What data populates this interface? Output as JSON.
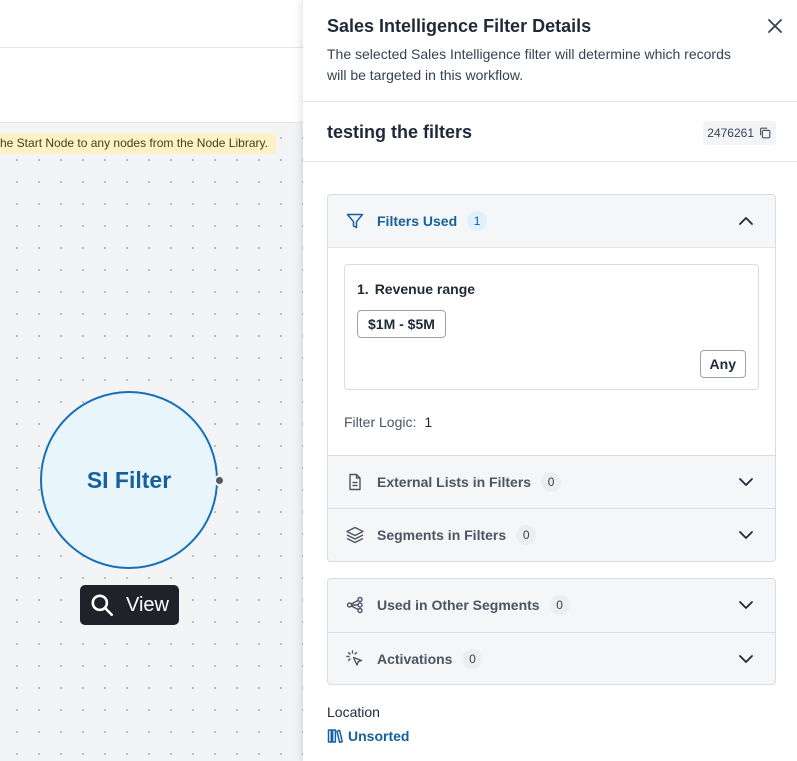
{
  "canvas": {
    "hint_text": "he Start Node to any nodes from the Node Library.",
    "node_label": "SI Filter",
    "view_label": "View"
  },
  "drawer": {
    "title": "Sales Intelligence Filter Details",
    "description": "The selected Sales Intelligence filter will determine which records will be targeted in this workflow.",
    "record_name": "testing the filters",
    "record_id": "2476261",
    "filters_used": {
      "label": "Filters Used",
      "count": "1",
      "items": [
        {
          "number": "1.",
          "name": "Revenue range",
          "value": "$1M - $5M",
          "match": "Any"
        }
      ],
      "logic_label": "Filter Logic:",
      "logic_value": "1"
    },
    "sections_a": [
      {
        "label": "External Lists in Filters",
        "count": "0",
        "icon": "document-icon"
      },
      {
        "label": "Segments in Filters",
        "count": "0",
        "icon": "layers-icon"
      }
    ],
    "sections_b": [
      {
        "label": "Used in Other Segments",
        "count": "0",
        "icon": "share-nodes-icon"
      },
      {
        "label": "Activations",
        "count": "0",
        "icon": "cursor-click-icon"
      }
    ],
    "location_label": "Location",
    "location_value": "Unsorted"
  },
  "colors": {
    "accent": "#15609e",
    "node_fill": "#e8f6fc",
    "node_border": "#1670b8",
    "hint_bg": "#fdf2c7"
  }
}
